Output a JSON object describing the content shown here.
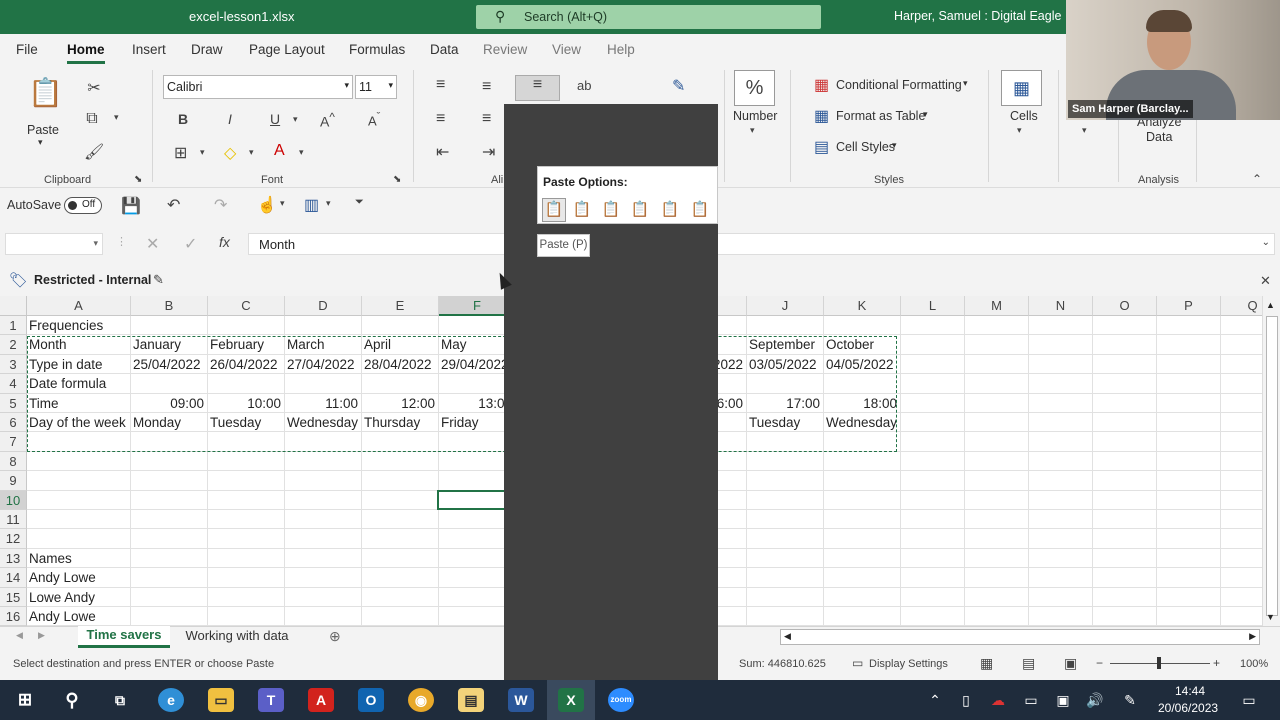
{
  "titlebar": {
    "file_name": "excel-lesson1.xlsx",
    "search_placeholder": "Search (Alt+Q)",
    "user": "Harper, Samuel : Digital Eagle"
  },
  "menu": [
    "File",
    "Home",
    "Insert",
    "Draw",
    "Page Layout",
    "Formulas",
    "Data",
    "Review",
    "View",
    "Help"
  ],
  "ribbon": {
    "clipboard": {
      "paste": "Paste",
      "label": "Clipboard"
    },
    "font": {
      "name": "Calibri",
      "size": "11",
      "label": "Font"
    },
    "alignment": {
      "label": "Ali"
    },
    "number": {
      "label": "Number"
    },
    "styles": {
      "conditional": "Conditional Formatting",
      "table": "Format as Table",
      "cell_styles": "Cell Styles",
      "label": "Styles"
    },
    "cells": {
      "label": "Cells"
    },
    "analysis": {
      "analyze": "Analyze",
      "data": "Data",
      "label": "Analysis"
    }
  },
  "qat": {
    "autosave": "AutoSave",
    "toggle": "Off"
  },
  "formula_bar": {
    "name_box": "",
    "fx": "fx",
    "content": "Month"
  },
  "infobar": {
    "label": "Restricted - Internal"
  },
  "columns": [
    {
      "name": "A",
      "width": 104
    },
    {
      "name": "B",
      "width": 77
    },
    {
      "name": "C",
      "width": 77
    },
    {
      "name": "D",
      "width": 77
    },
    {
      "name": "E",
      "width": 77
    },
    {
      "name": "F",
      "width": 77
    },
    {
      "name": "G",
      "width": 77
    },
    {
      "name": "H",
      "width": 77
    },
    {
      "name": "I",
      "width": 77
    },
    {
      "name": "J",
      "width": 77
    },
    {
      "name": "K",
      "width": 77
    },
    {
      "name": "L",
      "width": 64
    },
    {
      "name": "M",
      "width": 64
    },
    {
      "name": "N",
      "width": 64
    },
    {
      "name": "O",
      "width": 64
    },
    {
      "name": "P",
      "width": 64
    },
    {
      "name": "Q",
      "width": 64
    }
  ],
  "rows": [
    "1",
    "2",
    "3",
    "4",
    "5",
    "6",
    "7",
    "8",
    "9",
    "10",
    "11",
    "12",
    "13",
    "14",
    "15",
    "16"
  ],
  "cells": [
    {
      "row": 1,
      "col": 0,
      "v": "Frequencies"
    },
    {
      "row": 2,
      "col": 0,
      "v": "Month"
    },
    {
      "row": 2,
      "col": 1,
      "v": "January"
    },
    {
      "row": 2,
      "col": 2,
      "v": "February"
    },
    {
      "row": 2,
      "col": 3,
      "v": "March"
    },
    {
      "row": 2,
      "col": 4,
      "v": "April"
    },
    {
      "row": 2,
      "col": 5,
      "v": "May"
    },
    {
      "row": 2,
      "col": 9,
      "v": "September"
    },
    {
      "row": 2,
      "col": 10,
      "v": "October"
    },
    {
      "row": 3,
      "col": 0,
      "v": "Type in date"
    },
    {
      "row": 3,
      "col": 1,
      "v": "25/04/2022"
    },
    {
      "row": 3,
      "col": 2,
      "v": "26/04/2022"
    },
    {
      "row": 3,
      "col": 3,
      "v": "27/04/2022"
    },
    {
      "row": 3,
      "col": 4,
      "v": "28/04/2022"
    },
    {
      "row": 3,
      "col": 5,
      "v": "29/04/2022"
    },
    {
      "row": 3,
      "col": 8,
      "v": "02/05/2022",
      "align": "right"
    },
    {
      "row": 3,
      "col": 9,
      "v": "03/05/2022"
    },
    {
      "row": 3,
      "col": 10,
      "v": "04/05/2022"
    },
    {
      "row": 4,
      "col": 0,
      "v": "Date formula"
    },
    {
      "row": 5,
      "col": 0,
      "v": "Time"
    },
    {
      "row": 5,
      "col": 1,
      "v": "09:00",
      "align": "right"
    },
    {
      "row": 5,
      "col": 2,
      "v": "10:00",
      "align": "right"
    },
    {
      "row": 5,
      "col": 3,
      "v": "11:00",
      "align": "right"
    },
    {
      "row": 5,
      "col": 4,
      "v": "12:00",
      "align": "right"
    },
    {
      "row": 5,
      "col": 5,
      "v": "13:00",
      "align": "right"
    },
    {
      "row": 5,
      "col": 8,
      "v": "16:00",
      "align": "right"
    },
    {
      "row": 5,
      "col": 9,
      "v": "17:00",
      "align": "right"
    },
    {
      "row": 5,
      "col": 10,
      "v": "18:00",
      "align": "right"
    },
    {
      "row": 6,
      "col": 0,
      "v": "Day of the week"
    },
    {
      "row": 6,
      "col": 1,
      "v": "Monday"
    },
    {
      "row": 6,
      "col": 2,
      "v": "Tuesday"
    },
    {
      "row": 6,
      "col": 3,
      "v": "Wednesday"
    },
    {
      "row": 6,
      "col": 4,
      "v": "Thursday"
    },
    {
      "row": 6,
      "col": 5,
      "v": "Friday"
    },
    {
      "row": 6,
      "col": 9,
      "v": "Tuesday"
    },
    {
      "row": 6,
      "col": 10,
      "v": "Wednesday"
    },
    {
      "row": 13,
      "col": 0,
      "v": "Names"
    },
    {
      "row": 14,
      "col": 0,
      "v": "Andy Lowe"
    },
    {
      "row": 15,
      "col": 0,
      "v": "Lowe Andy"
    },
    {
      "row": 16,
      "col": 0,
      "v": "Andy Lowe"
    }
  ],
  "active": {
    "col": "F",
    "row": "10"
  },
  "sheet_tabs": [
    "Time savers",
    "Working with data"
  ],
  "status": {
    "message": "Select destination and press ENTER or choose Paste",
    "sum": "Sum: 446810.625",
    "display": "Display Settings",
    "zoom": "100%"
  },
  "paste_options": {
    "title": "Paste Options:",
    "tooltip": "Paste (P)",
    "icons": [
      "paste-icon",
      "paste-values-icon",
      "paste-formulas-icon",
      "transpose-icon",
      "paste-formatting-icon",
      "paste-link-icon"
    ]
  },
  "taskbar": {
    "time": "14:44",
    "date": "20/06/2023"
  },
  "webcam": {
    "name": "Sam Harper (Barclay..."
  }
}
